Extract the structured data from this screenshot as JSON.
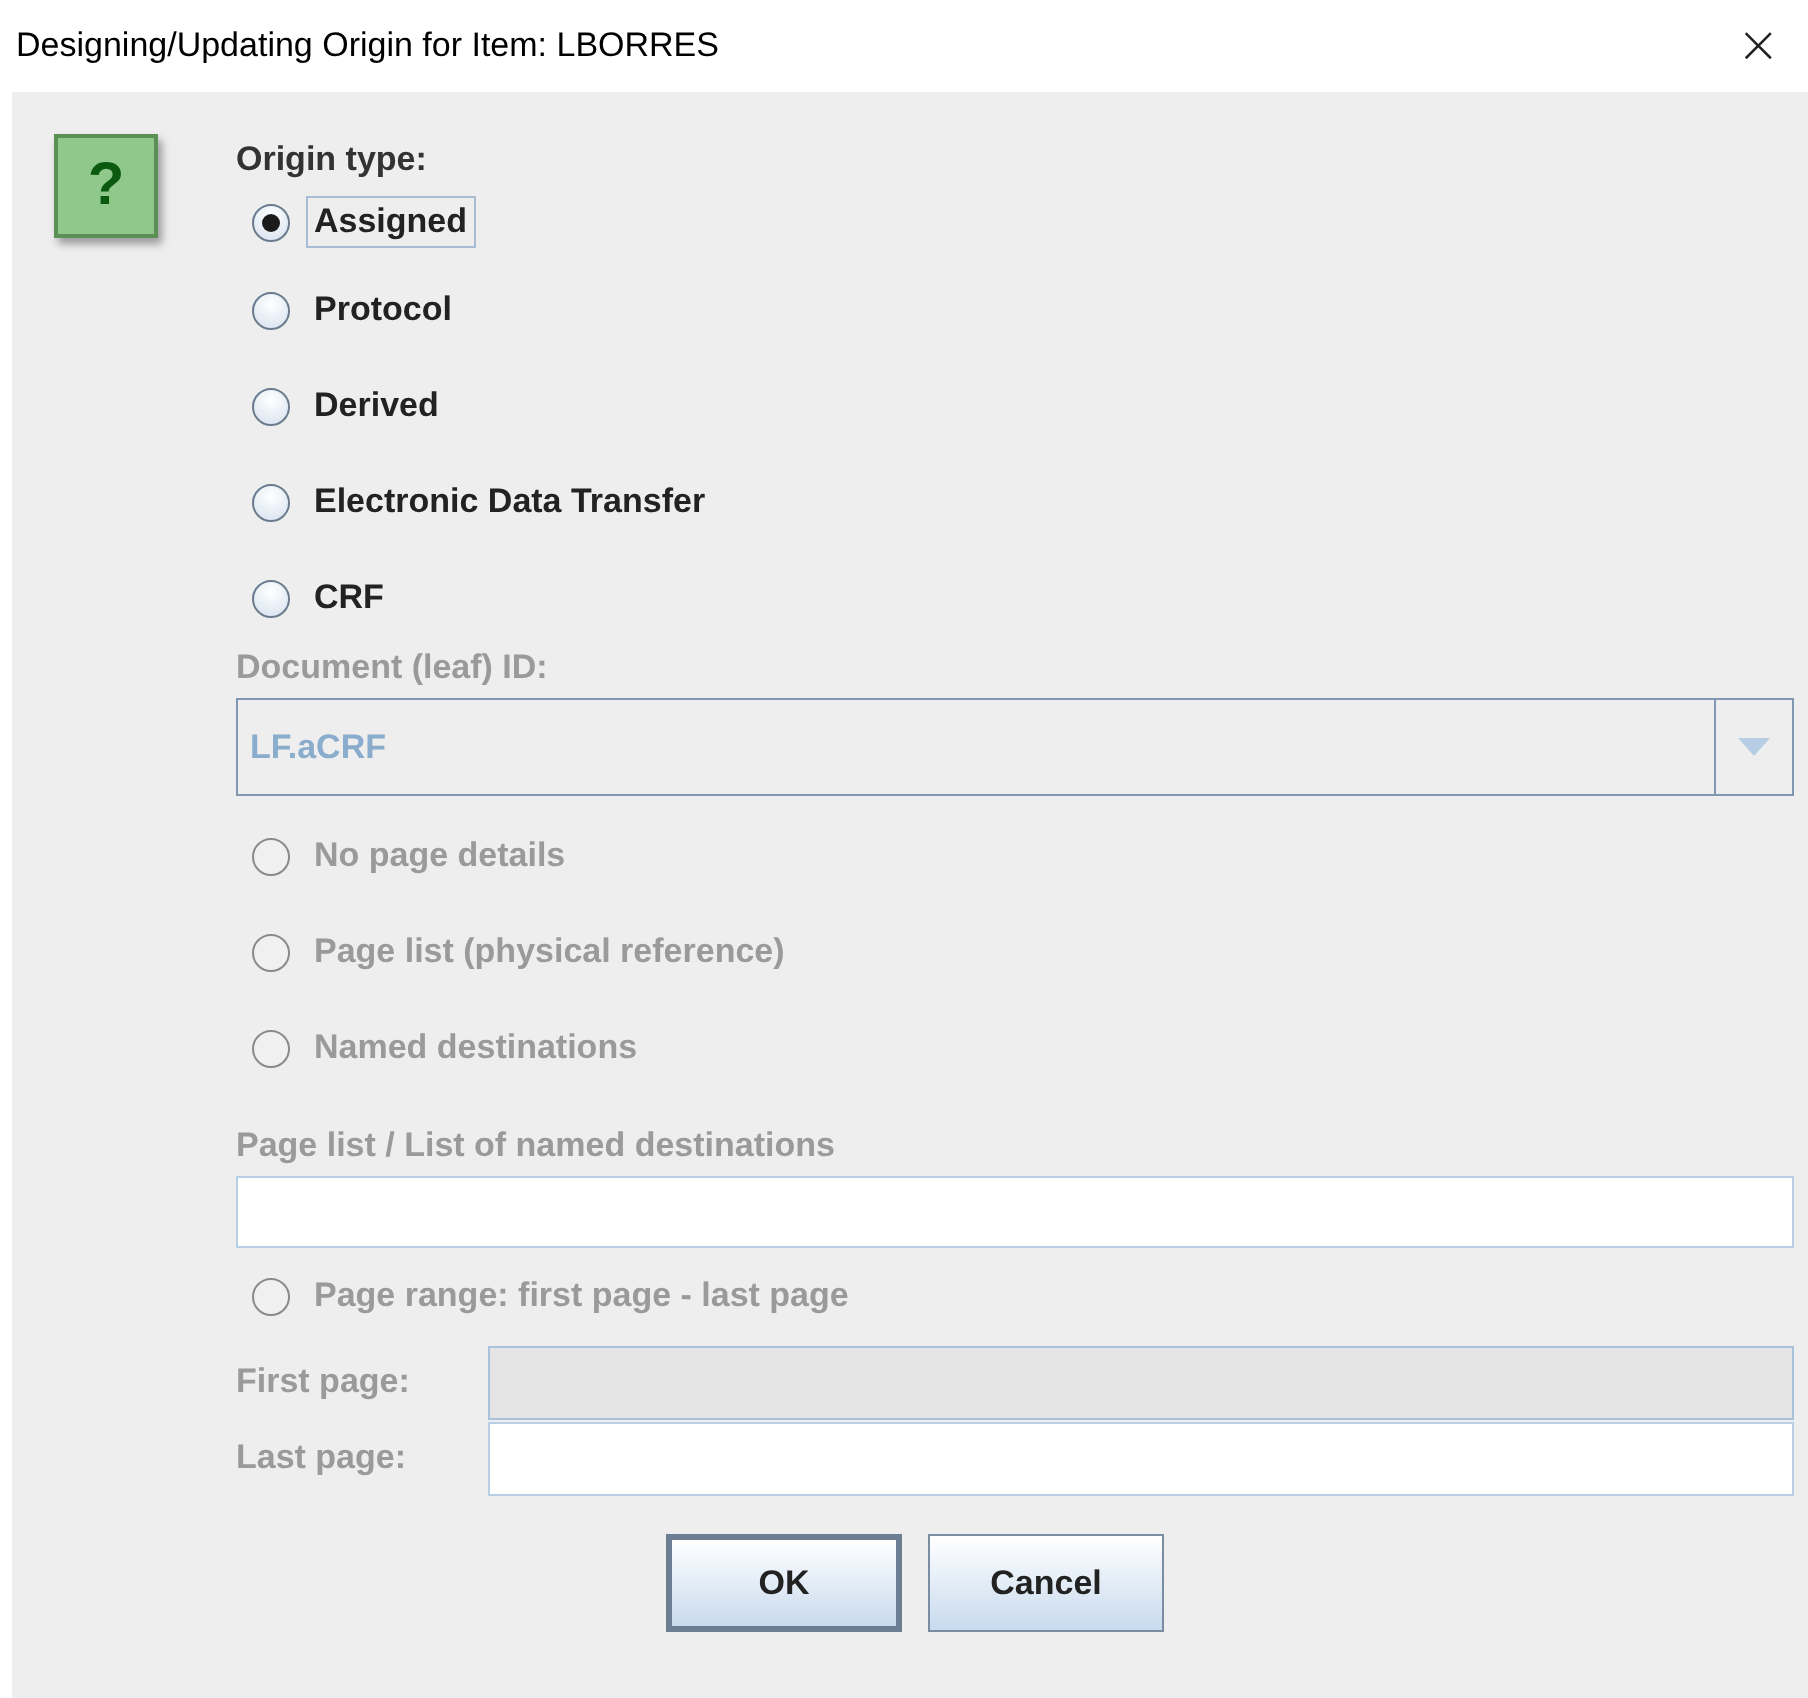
{
  "window": {
    "title": "Designing/Updating Origin for Item: LBORRES",
    "close": "×"
  },
  "help_icon": {
    "glyph": "?"
  },
  "origin_type": {
    "label": "Origin type:",
    "options": [
      {
        "label": "Assigned",
        "selected": true,
        "focused": true,
        "disabled": false
      },
      {
        "label": "Protocol",
        "selected": false,
        "focused": false,
        "disabled": false
      },
      {
        "label": "Derived",
        "selected": false,
        "focused": false,
        "disabled": false
      },
      {
        "label": "Electronic Data Transfer",
        "selected": false,
        "focused": false,
        "disabled": false
      },
      {
        "label": "CRF",
        "selected": false,
        "focused": false,
        "disabled": false
      }
    ]
  },
  "document_id": {
    "label": "Document (leaf) ID:",
    "value": "LF.aCRF",
    "disabled": true
  },
  "page_options": [
    {
      "label": "No page details",
      "selected": false,
      "disabled": true
    },
    {
      "label": "Page list (physical reference)",
      "selected": false,
      "disabled": true
    },
    {
      "label": "Named destinations",
      "selected": false,
      "disabled": true
    }
  ],
  "page_list": {
    "label": "Page list / List of named destinations",
    "disabled": false
  },
  "page_range": {
    "label": "Page range: first page - last page",
    "selected": false,
    "disabled": true
  },
  "range_fields": [
    {
      "label": "First page:",
      "disabled": true
    },
    {
      "label": "Last page:",
      "disabled": false
    }
  ],
  "buttons": [
    {
      "label": "OK",
      "default": true
    },
    {
      "label": "Cancel",
      "default": false
    }
  ]
}
